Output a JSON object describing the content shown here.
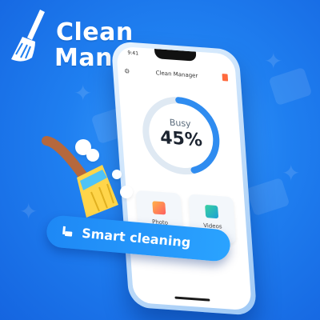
{
  "brand": {
    "title_line1": "Clean",
    "title_line2": "Manager"
  },
  "phone": {
    "status_time": "9:41",
    "app_title": "Clean Manager",
    "gauge": {
      "label": "Busy",
      "value_text": "45%",
      "fraction": 0.45,
      "track_color": "#dfe9f3",
      "fill_color": "#2f8cf0"
    },
    "tiles": [
      {
        "label": "Photo",
        "icon": "photo-icon"
      },
      {
        "label": "Videos",
        "icon": "video-icon"
      }
    ]
  },
  "cta": {
    "label": "Smart cleaning",
    "icon": "broom-icon"
  },
  "colors": {
    "background": "#1f7ff0",
    "accent": "#2aa3ff",
    "broom_handle": "#b5683d",
    "broom_bristles": "#ffd54a"
  }
}
